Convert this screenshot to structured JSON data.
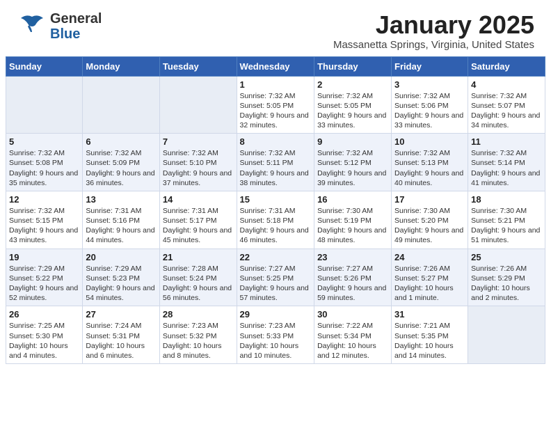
{
  "header": {
    "logo_general": "General",
    "logo_blue": "Blue",
    "title": "January 2025",
    "subtitle": "Massanetta Springs, Virginia, United States"
  },
  "weekdays": [
    "Sunday",
    "Monday",
    "Tuesday",
    "Wednesday",
    "Thursday",
    "Friday",
    "Saturday"
  ],
  "weeks": [
    [
      {
        "day": "",
        "info": ""
      },
      {
        "day": "",
        "info": ""
      },
      {
        "day": "",
        "info": ""
      },
      {
        "day": "1",
        "info": "Sunrise: 7:32 AM\nSunset: 5:05 PM\nDaylight: 9 hours and 32 minutes."
      },
      {
        "day": "2",
        "info": "Sunrise: 7:32 AM\nSunset: 5:05 PM\nDaylight: 9 hours and 33 minutes."
      },
      {
        "day": "3",
        "info": "Sunrise: 7:32 AM\nSunset: 5:06 PM\nDaylight: 9 hours and 33 minutes."
      },
      {
        "day": "4",
        "info": "Sunrise: 7:32 AM\nSunset: 5:07 PM\nDaylight: 9 hours and 34 minutes."
      }
    ],
    [
      {
        "day": "5",
        "info": "Sunrise: 7:32 AM\nSunset: 5:08 PM\nDaylight: 9 hours and 35 minutes."
      },
      {
        "day": "6",
        "info": "Sunrise: 7:32 AM\nSunset: 5:09 PM\nDaylight: 9 hours and 36 minutes."
      },
      {
        "day": "7",
        "info": "Sunrise: 7:32 AM\nSunset: 5:10 PM\nDaylight: 9 hours and 37 minutes."
      },
      {
        "day": "8",
        "info": "Sunrise: 7:32 AM\nSunset: 5:11 PM\nDaylight: 9 hours and 38 minutes."
      },
      {
        "day": "9",
        "info": "Sunrise: 7:32 AM\nSunset: 5:12 PM\nDaylight: 9 hours and 39 minutes."
      },
      {
        "day": "10",
        "info": "Sunrise: 7:32 AM\nSunset: 5:13 PM\nDaylight: 9 hours and 40 minutes."
      },
      {
        "day": "11",
        "info": "Sunrise: 7:32 AM\nSunset: 5:14 PM\nDaylight: 9 hours and 41 minutes."
      }
    ],
    [
      {
        "day": "12",
        "info": "Sunrise: 7:32 AM\nSunset: 5:15 PM\nDaylight: 9 hours and 43 minutes."
      },
      {
        "day": "13",
        "info": "Sunrise: 7:31 AM\nSunset: 5:16 PM\nDaylight: 9 hours and 44 minutes."
      },
      {
        "day": "14",
        "info": "Sunrise: 7:31 AM\nSunset: 5:17 PM\nDaylight: 9 hours and 45 minutes."
      },
      {
        "day": "15",
        "info": "Sunrise: 7:31 AM\nSunset: 5:18 PM\nDaylight: 9 hours and 46 minutes."
      },
      {
        "day": "16",
        "info": "Sunrise: 7:30 AM\nSunset: 5:19 PM\nDaylight: 9 hours and 48 minutes."
      },
      {
        "day": "17",
        "info": "Sunrise: 7:30 AM\nSunset: 5:20 PM\nDaylight: 9 hours and 49 minutes."
      },
      {
        "day": "18",
        "info": "Sunrise: 7:30 AM\nSunset: 5:21 PM\nDaylight: 9 hours and 51 minutes."
      }
    ],
    [
      {
        "day": "19",
        "info": "Sunrise: 7:29 AM\nSunset: 5:22 PM\nDaylight: 9 hours and 52 minutes."
      },
      {
        "day": "20",
        "info": "Sunrise: 7:29 AM\nSunset: 5:23 PM\nDaylight: 9 hours and 54 minutes."
      },
      {
        "day": "21",
        "info": "Sunrise: 7:28 AM\nSunset: 5:24 PM\nDaylight: 9 hours and 56 minutes."
      },
      {
        "day": "22",
        "info": "Sunrise: 7:27 AM\nSunset: 5:25 PM\nDaylight: 9 hours and 57 minutes."
      },
      {
        "day": "23",
        "info": "Sunrise: 7:27 AM\nSunset: 5:26 PM\nDaylight: 9 hours and 59 minutes."
      },
      {
        "day": "24",
        "info": "Sunrise: 7:26 AM\nSunset: 5:27 PM\nDaylight: 10 hours and 1 minute."
      },
      {
        "day": "25",
        "info": "Sunrise: 7:26 AM\nSunset: 5:29 PM\nDaylight: 10 hours and 2 minutes."
      }
    ],
    [
      {
        "day": "26",
        "info": "Sunrise: 7:25 AM\nSunset: 5:30 PM\nDaylight: 10 hours and 4 minutes."
      },
      {
        "day": "27",
        "info": "Sunrise: 7:24 AM\nSunset: 5:31 PM\nDaylight: 10 hours and 6 minutes."
      },
      {
        "day": "28",
        "info": "Sunrise: 7:23 AM\nSunset: 5:32 PM\nDaylight: 10 hours and 8 minutes."
      },
      {
        "day": "29",
        "info": "Sunrise: 7:23 AM\nSunset: 5:33 PM\nDaylight: 10 hours and 10 minutes."
      },
      {
        "day": "30",
        "info": "Sunrise: 7:22 AM\nSunset: 5:34 PM\nDaylight: 10 hours and 12 minutes."
      },
      {
        "day": "31",
        "info": "Sunrise: 7:21 AM\nSunset: 5:35 PM\nDaylight: 10 hours and 14 minutes."
      },
      {
        "day": "",
        "info": ""
      }
    ]
  ]
}
